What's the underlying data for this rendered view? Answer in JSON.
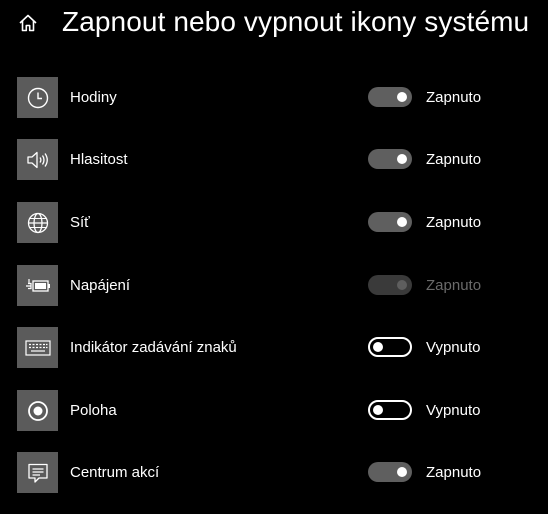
{
  "header": {
    "title": "Zapnout nebo vypnout ikony systému",
    "home_icon": "home-icon"
  },
  "colors": {
    "background": "#000000",
    "icon_tile": "#5b5b5b",
    "toggle_on_track": "#5f5f5f",
    "toggle_disabled_track": "#3a3a3a",
    "disabled_text": "#6a6a6a"
  },
  "items": [
    {
      "label": "Hodiny",
      "icon": "clock-icon",
      "state": "Zapnuto",
      "on": true,
      "disabled": false
    },
    {
      "label": "Hlasitost",
      "icon": "speaker-icon",
      "state": "Zapnuto",
      "on": true,
      "disabled": false
    },
    {
      "label": "Síť",
      "icon": "globe-icon",
      "state": "Zapnuto",
      "on": true,
      "disabled": false
    },
    {
      "label": "Napájení",
      "icon": "battery-plug-icon",
      "state": "Zapnuto",
      "on": true,
      "disabled": true
    },
    {
      "label": "Indikátor zadávání znaků",
      "icon": "keyboard-icon",
      "state": "Vypnuto",
      "on": false,
      "disabled": false
    },
    {
      "label": "Poloha",
      "icon": "location-icon",
      "state": "Vypnuto",
      "on": false,
      "disabled": false
    },
    {
      "label": "Centrum akcí",
      "icon": "action-center-icon",
      "state": "Zapnuto",
      "on": true,
      "disabled": false
    }
  ]
}
